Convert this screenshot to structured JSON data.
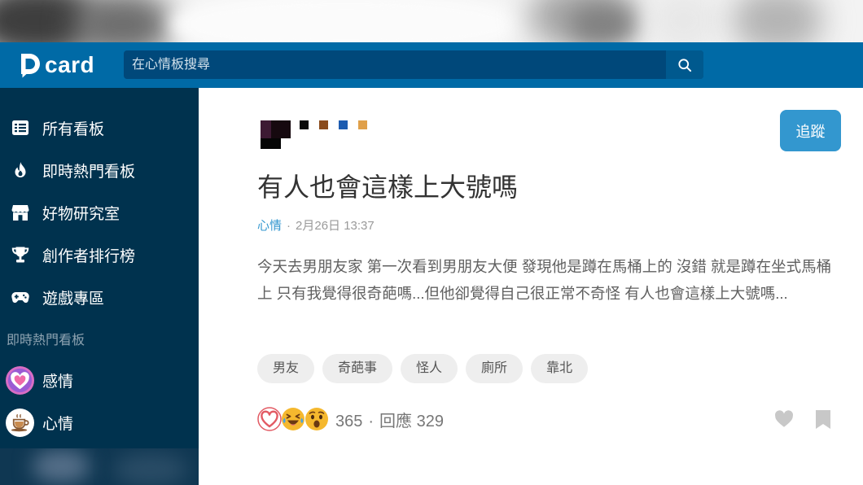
{
  "header": {
    "logo": {
      "mark": "D",
      "wordmark": "card"
    },
    "search_placeholder": "在心情板搜尋",
    "search_icon": "search-icon"
  },
  "sidebar": {
    "items": [
      {
        "label": "所有看板",
        "icon": "list-icon"
      },
      {
        "label": "即時熱門看板",
        "icon": "fire-icon"
      },
      {
        "label": "好物研究室",
        "icon": "store-icon"
      },
      {
        "label": "創作者排行榜",
        "icon": "trophy-icon"
      },
      {
        "label": "遊戲專區",
        "icon": "gamepad-icon"
      }
    ],
    "section_title": "即時熱門看板",
    "boards": [
      {
        "label": "感情",
        "icon": "heart-board-avatar-icon"
      },
      {
        "label": "心情",
        "icon": "coffee-board-avatar-icon"
      }
    ]
  },
  "post": {
    "follow_label": "追蹤",
    "title": "有人也會這樣上大號嗎",
    "board": "心情",
    "meta_separator": "·",
    "date": "2月26日 13:37",
    "excerpt": [
      "今天去男朋友家 第一次看到男朋友大便 發現他是蹲在馬桶上的 沒錯 就是蹲在坐式馬桶",
      "上 只有我覺得很奇葩嗎...但他卻覺得自己很正常不奇怪 有人也會這樣上大號嗎..."
    ],
    "tags": [
      "男友",
      "奇葩事",
      "怪人",
      "廁所",
      "靠北"
    ],
    "reactions": [
      "heart-reaction-icon",
      "laugh-reaction-icon",
      "surprised-reaction-icon"
    ],
    "reaction_count": "365",
    "stats_separator": "·",
    "reply_label": "回應",
    "reply_count": "329",
    "actions": {
      "like_icon": "heart-icon",
      "save_icon": "bookmark-icon"
    }
  },
  "colors": {
    "header": "#006aa6",
    "search_bg": "#00487a",
    "sidebar": "#00324e",
    "accent": "#3397cf",
    "tag_bg": "#eeeeee",
    "muted_text": "#777777"
  }
}
